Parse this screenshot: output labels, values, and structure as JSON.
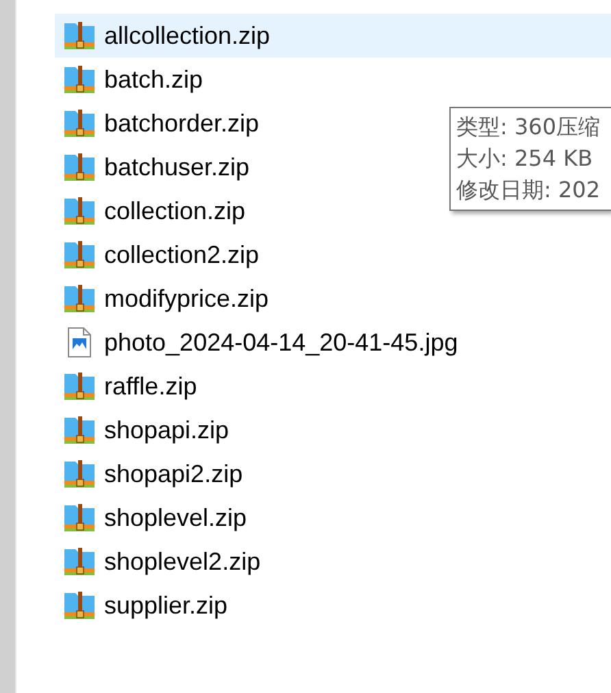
{
  "files": [
    {
      "name": "allcollection.zip",
      "kind": "zip",
      "selected": true
    },
    {
      "name": "batch.zip",
      "kind": "zip",
      "selected": false
    },
    {
      "name": "batchorder.zip",
      "kind": "zip",
      "selected": false
    },
    {
      "name": "batchuser.zip",
      "kind": "zip",
      "selected": false
    },
    {
      "name": "collection.zip",
      "kind": "zip",
      "selected": false
    },
    {
      "name": "collection2.zip",
      "kind": "zip",
      "selected": false
    },
    {
      "name": "modifyprice.zip",
      "kind": "zip",
      "selected": false
    },
    {
      "name": "photo_2024-04-14_20-41-45.jpg",
      "kind": "image",
      "selected": false
    },
    {
      "name": "raffle.zip",
      "kind": "zip",
      "selected": false
    },
    {
      "name": "shopapi.zip",
      "kind": "zip",
      "selected": false
    },
    {
      "name": "shopapi2.zip",
      "kind": "zip",
      "selected": false
    },
    {
      "name": "shoplevel.zip",
      "kind": "zip",
      "selected": false
    },
    {
      "name": "shoplevel2.zip",
      "kind": "zip",
      "selected": false
    },
    {
      "name": "supplier.zip",
      "kind": "zip",
      "selected": false
    }
  ],
  "tooltip": {
    "lines": [
      "类型: 360压缩",
      "大小: 254 KB",
      "修改日期: 202"
    ]
  }
}
